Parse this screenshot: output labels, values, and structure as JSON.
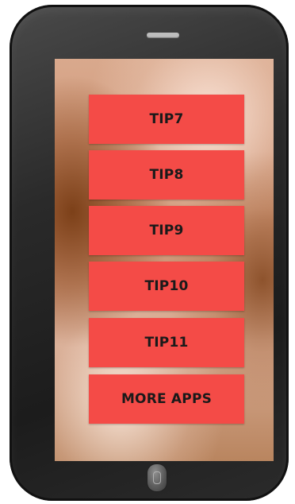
{
  "menu": {
    "items": [
      {
        "label": "TIP7"
      },
      {
        "label": "TIP8"
      },
      {
        "label": "TIP9"
      },
      {
        "label": "TIP10"
      },
      {
        "label": "TIP11"
      },
      {
        "label": "MORE APPS"
      }
    ]
  },
  "colors": {
    "button_bg": "#f44b47",
    "button_text": "#1a1a1a",
    "device_body": "#2a2a2a"
  },
  "icons": {
    "speaker": "speaker-grille-icon",
    "home": "home-button-icon"
  }
}
